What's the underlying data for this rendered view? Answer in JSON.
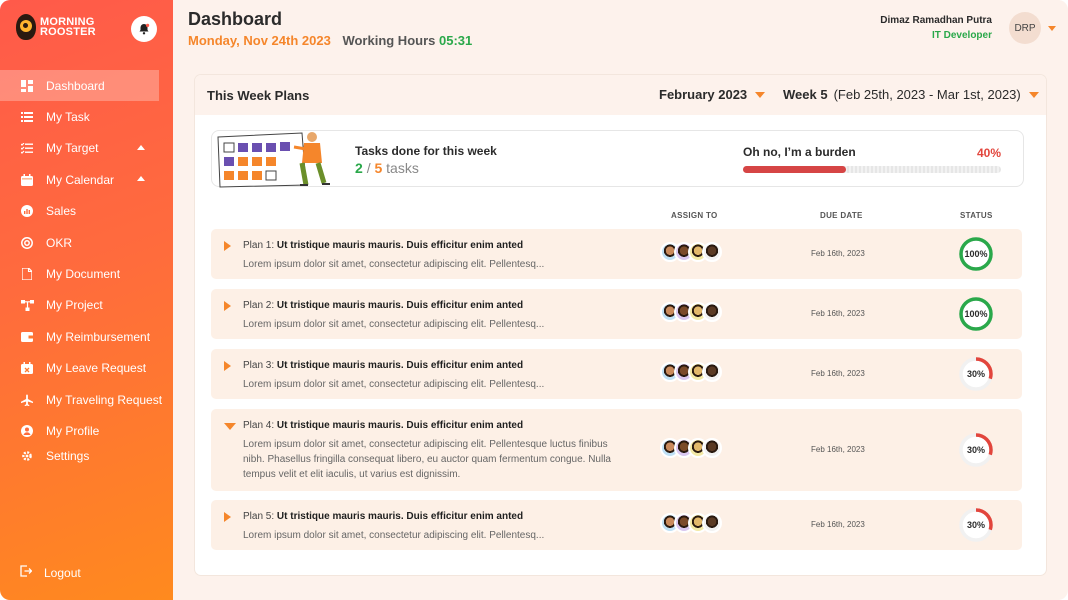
{
  "brand": {
    "line1": "MORNING",
    "line2": "ROOSTER"
  },
  "sidebar": {
    "items": [
      {
        "label": "Dashboard",
        "icon": "dashboard-icon",
        "active": true
      },
      {
        "label": "My Task",
        "icon": "list-icon"
      },
      {
        "label": "My Target",
        "icon": "checklist-icon",
        "expandable": true
      },
      {
        "label": "My Calendar",
        "icon": "calendar-icon",
        "expandable": true
      },
      {
        "label": "Sales",
        "icon": "sales-icon"
      },
      {
        "label": "OKR",
        "icon": "target-icon"
      },
      {
        "label": "My Document",
        "icon": "document-icon"
      },
      {
        "label": "My Project",
        "icon": "project-icon"
      },
      {
        "label": "My Reimbursement",
        "icon": "wallet-icon"
      },
      {
        "label": "My Leave Request",
        "icon": "calendar-x-icon"
      },
      {
        "label": "My Traveling Request",
        "icon": "airplane-icon"
      },
      {
        "label": "My Profile",
        "icon": "user-icon"
      },
      {
        "label": "Settings",
        "icon": "gear-icon"
      }
    ],
    "logout": "Logout"
  },
  "header": {
    "title": "Dashboard",
    "date": "Monday, Nov 24th 2023",
    "working_hours_label": "Working Hours",
    "working_hours": "05:31",
    "user_name": "Dimaz Ramadhan Putra",
    "user_role": "IT Developer",
    "avatar_initials": "DRP"
  },
  "plans_card": {
    "title": "This Week Plans",
    "month": "February 2023",
    "week": "Week 5",
    "week_range": "(Feb 25th, 2023 - Mar 1st, 2023)",
    "summary": {
      "label": "Tasks done for this week",
      "done": "2",
      "sep": "/",
      "total": "5",
      "unit": "tasks",
      "progress_label": "Oh no, I’m a burden",
      "progress_pct_text": "40%",
      "progress_value": 0.4
    },
    "columns": {
      "assign": "ASSIGN TO",
      "due": "DUE DATE",
      "status": "STATUS"
    },
    "plans": [
      {
        "prefix": "Plan 1:",
        "title": "Ut tristique mauris mauris. Duis efficitur enim anted",
        "desc": "Lorem ipsum dolor sit amet, consectetur adipiscing elit. Pellentesq...",
        "due": "Feb 16th, 2023",
        "status_text": "100%",
        "status_value": 1.0,
        "expanded": false
      },
      {
        "prefix": "Plan 2:",
        "title": "Ut tristique mauris mauris. Duis efficitur enim anted",
        "desc": "Lorem ipsum dolor sit amet, consectetur adipiscing elit. Pellentesq...",
        "due": "Feb 16th, 2023",
        "status_text": "100%",
        "status_value": 1.0,
        "expanded": false
      },
      {
        "prefix": "Plan 3:",
        "title": "Ut tristique mauris mauris. Duis efficitur enim anted",
        "desc": "Lorem ipsum dolor sit amet, consectetur adipiscing elit. Pellentesq...",
        "due": "Feb 16th, 2023",
        "status_text": "30%",
        "status_value": 0.3,
        "expanded": false
      },
      {
        "prefix": "Plan 4:",
        "title": "Ut tristique mauris mauris. Duis efficitur enim anted",
        "desc": "Lorem ipsum dolor sit amet, consectetur adipiscing elit. Pellentesque luctus finibus nibh. Phasellus fringilla consequat libero, eu auctor quam fermentum congue. Nulla tempus velit et elit iaculis, ut varius est dignissim.",
        "due": "Feb 16th, 2023",
        "status_text": "30%",
        "status_value": 0.3,
        "expanded": true
      },
      {
        "prefix": "Plan 5:",
        "title": "Ut tristique mauris mauris. Duis efficitur enim anted",
        "desc": "Lorem ipsum dolor sit amet, consectetur adipiscing elit. Pellentesq...",
        "due": "Feb 16th, 2023",
        "status_text": "30%",
        "status_value": 0.3,
        "expanded": false
      }
    ]
  },
  "colors": {
    "accent": "#f5862b",
    "success": "#2aa84a",
    "danger": "#e2453c"
  }
}
